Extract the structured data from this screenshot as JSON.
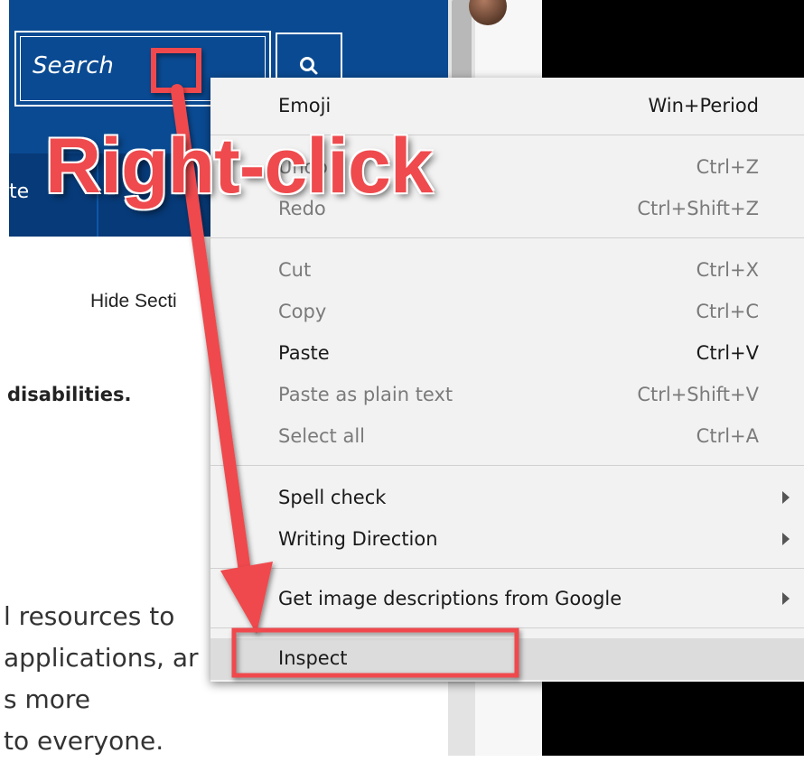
{
  "website": {
    "search": {
      "placeholder": "Search",
      "button_icon": "search-icon"
    },
    "nav_partial_text": "te",
    "hide_section_text": "Hide Secti",
    "bold_text": "disabilities.",
    "paragraph_lines": [
      "l resources to",
      "applications, ar",
      "s more",
      "to everyone."
    ]
  },
  "context_menu": {
    "items": [
      {
        "label": "Emoji",
        "shortcut": "Win+Period",
        "enabled": true
      },
      {
        "label": "Undo",
        "shortcut": "Ctrl+Z",
        "enabled": false
      },
      {
        "label": "Redo",
        "shortcut": "Ctrl+Shift+Z",
        "enabled": false
      },
      {
        "label": "Cut",
        "shortcut": "Ctrl+X",
        "enabled": false
      },
      {
        "label": "Copy",
        "shortcut": "Ctrl+C",
        "enabled": false
      },
      {
        "label": "Paste",
        "shortcut": "Ctrl+V",
        "enabled": true
      },
      {
        "label": "Paste as plain text",
        "shortcut": "Ctrl+Shift+V",
        "enabled": false
      },
      {
        "label": "Select all",
        "shortcut": "Ctrl+A",
        "enabled": false
      },
      {
        "label": "Spell check",
        "submenu": true,
        "enabled": true
      },
      {
        "label": "Writing Direction",
        "submenu": true,
        "enabled": true
      },
      {
        "label": "Get image descriptions from Google",
        "submenu": true,
        "enabled": true
      },
      {
        "label": "Inspect",
        "enabled": true,
        "highlighted": true
      }
    ]
  },
  "annotation": {
    "callout_text": "Right-click",
    "color": "#ef4a4d"
  }
}
